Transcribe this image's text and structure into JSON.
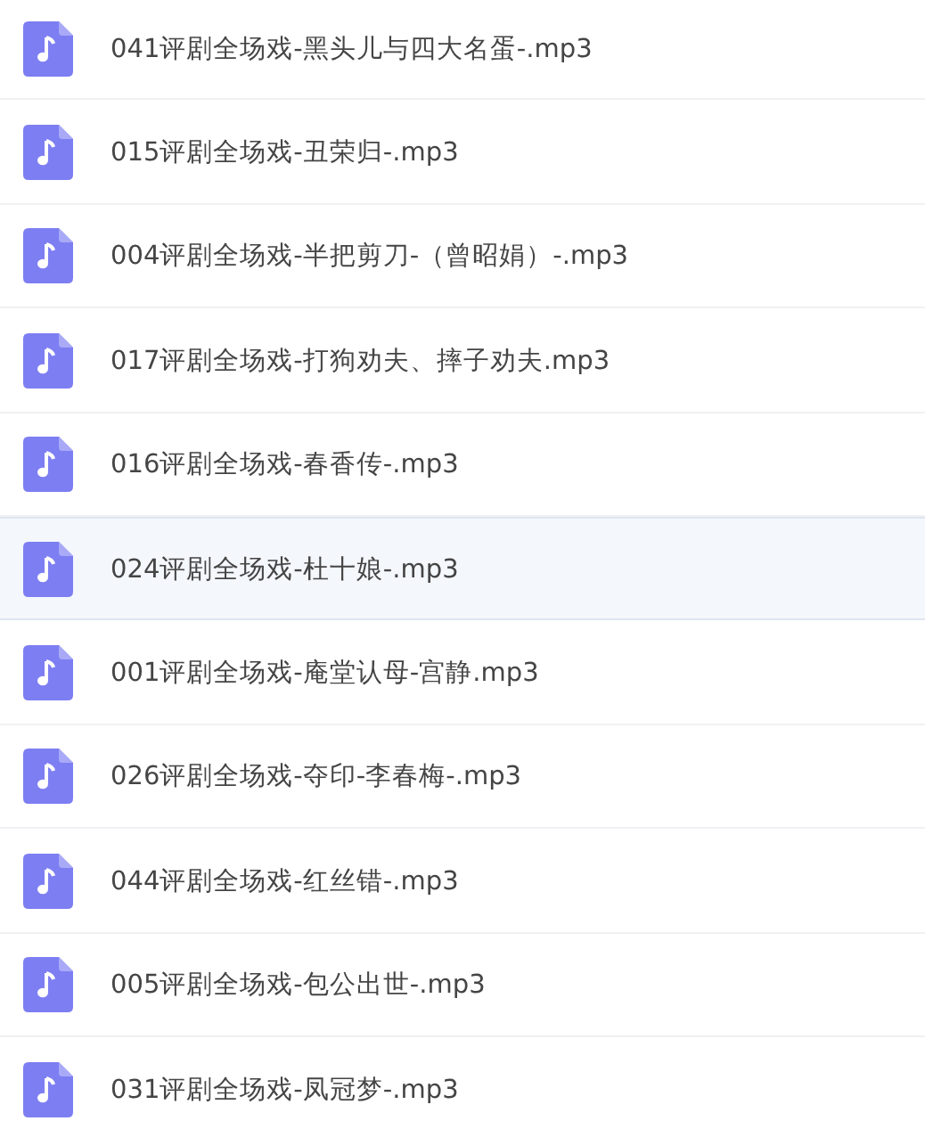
{
  "files": [
    {
      "name": "041评剧全场戏-黑头儿与四大名蛋-.mp3",
      "selected": false
    },
    {
      "name": "015评剧全场戏-丑荣归-.mp3",
      "selected": false
    },
    {
      "name": "004评剧全场戏-半把剪刀-（曾昭娟）-.mp3",
      "selected": false
    },
    {
      "name": "017评剧全场戏-打狗劝夫、摔子劝夫.mp3",
      "selected": false
    },
    {
      "name": "016评剧全场戏-春香传-.mp3",
      "selected": false
    },
    {
      "name": "024评剧全场戏-杜十娘-.mp3",
      "selected": true
    },
    {
      "name": "001评剧全场戏-庵堂认母-宫静.mp3",
      "selected": false
    },
    {
      "name": "026评剧全场戏-夺印-李春梅-.mp3",
      "selected": false
    },
    {
      "name": "044评剧全场戏-红丝错-.mp3",
      "selected": false
    },
    {
      "name": "005评剧全场戏-包公出世-.mp3",
      "selected": false
    },
    {
      "name": "031评剧全场戏-凤冠梦-.mp3",
      "selected": false
    }
  ]
}
